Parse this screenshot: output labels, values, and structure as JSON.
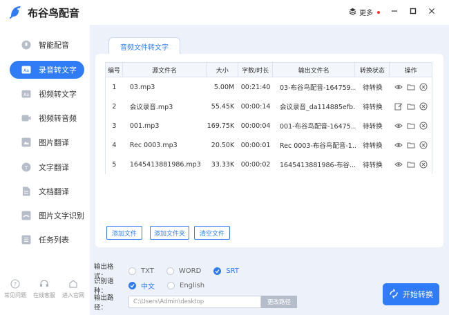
{
  "app": {
    "title": "布谷鸟配音",
    "more_label": "更多"
  },
  "sidebar": {
    "items": [
      {
        "label": "智能配音",
        "icon": "mic-icon",
        "active": false
      },
      {
        "label": "录音转文字",
        "icon": "audio-text-icon",
        "active": true
      },
      {
        "label": "视频转文字",
        "icon": "video-text-icon",
        "active": false
      },
      {
        "label": "视频转音频",
        "icon": "video-audio-icon",
        "active": false
      },
      {
        "label": "图片翻译",
        "icon": "image-translate-icon",
        "active": false
      },
      {
        "label": "文字翻译",
        "icon": "text-translate-icon",
        "active": false
      },
      {
        "label": "文档翻译",
        "icon": "doc-translate-icon",
        "active": false
      },
      {
        "label": "图片文字识别",
        "icon": "ocr-icon",
        "active": false
      },
      {
        "label": "任务列表",
        "icon": "task-list-icon",
        "active": false
      }
    ],
    "bottom": [
      {
        "label": "常见问题",
        "icon": "help-icon"
      },
      {
        "label": "在线客服",
        "icon": "service-icon"
      },
      {
        "label": "进入官网",
        "icon": "website-icon"
      }
    ]
  },
  "main": {
    "tab_label": "音频文件转文字",
    "table": {
      "headers": [
        "编号",
        "源文件名",
        "大小",
        "字数/时长",
        "输出文件名",
        "转换状态",
        "操作"
      ],
      "rows": [
        {
          "id": "1",
          "name": "03.mp3",
          "size": "5.00M",
          "duration": "00:21:40",
          "output": "03-布谷鸟配音-164759...",
          "status": "待转换",
          "first_op": "eye-icon"
        },
        {
          "id": "2",
          "name": "会议录音.mp3",
          "size": "55.45K",
          "duration": "00:00:14",
          "output": "会议录音_da114885efb...",
          "status": "待转换",
          "first_op": "edit-icon"
        },
        {
          "id": "3",
          "name": "001.mp3",
          "size": "169.75K",
          "duration": "00:00:04",
          "output": "001-布谷鸟配音-16475...",
          "status": "待转换",
          "first_op": "eye-icon"
        },
        {
          "id": "4",
          "name": "Rec 0003.mp3",
          "size": "20.50K",
          "duration": "00:00:01",
          "output": "Rec 0003-布谷鸟配音-1...",
          "status": "待转换",
          "first_op": "eye-icon"
        },
        {
          "id": "5",
          "name": "1645413881986.mp3",
          "size": "33.33K",
          "duration": "00:00:02",
          "output": "1645413881986-布谷...",
          "status": "待转换",
          "first_op": "eye-icon"
        }
      ]
    },
    "buttons": {
      "add_file": "添加文件",
      "add_folder": "添加文件夹",
      "clear": "清空文件"
    },
    "format": {
      "label": "输出格式：",
      "options": [
        "TXT",
        "WORD",
        "SRT"
      ],
      "selected": "SRT"
    },
    "language": {
      "label": "识别语种：",
      "options": [
        "中文",
        "English"
      ],
      "selected": "中文"
    },
    "path": {
      "label": "输出路径：",
      "value": "C:\\Users\\Admin\\desktop",
      "button": "更改路径"
    },
    "start_label": "开始转换"
  },
  "colors": {
    "accent": "#2f7cf6",
    "main_bg": "#edf2fa",
    "more_dot": "#ff3333"
  }
}
